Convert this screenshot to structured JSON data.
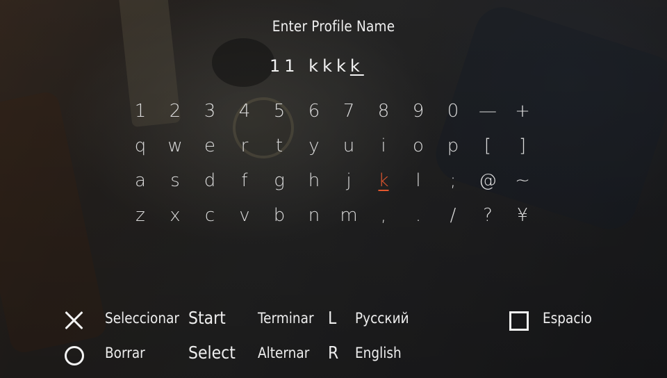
{
  "screen": {
    "title": "Enter Profile Name",
    "entry_text": "11 kkk",
    "entry_caret_char": "k"
  },
  "keyboard": {
    "rows": [
      [
        "1",
        "2",
        "3",
        "4",
        "5",
        "6",
        "7",
        "8",
        "9",
        "0",
        "—",
        "+"
      ],
      [
        "q",
        "w",
        "e",
        "r",
        "t",
        "y",
        "u",
        "i",
        "o",
        "p",
        "[",
        "]"
      ],
      [
        "a",
        "s",
        "d",
        "f",
        "g",
        "h",
        "j",
        "k",
        "l",
        ";",
        "@",
        "~"
      ],
      [
        "z",
        "x",
        "c",
        "v",
        "b",
        "n",
        "m",
        ",",
        ".",
        "/",
        "?",
        "¥"
      ]
    ],
    "selected_key": "k",
    "selected_color": "#e4572e"
  },
  "controls": {
    "cross_label": "Seleccionar",
    "circle_label": "Borrar",
    "start_button": "Start",
    "start_label": "Terminar",
    "select_button": "Select",
    "select_label": "Alternar",
    "l_button": "L",
    "l_label": "Русский",
    "r_button": "R",
    "r_label": "English",
    "square_label": "Espacio",
    "cross_icon": "cross-icon",
    "circle_icon": "circle-icon",
    "square_icon": "square-icon"
  }
}
